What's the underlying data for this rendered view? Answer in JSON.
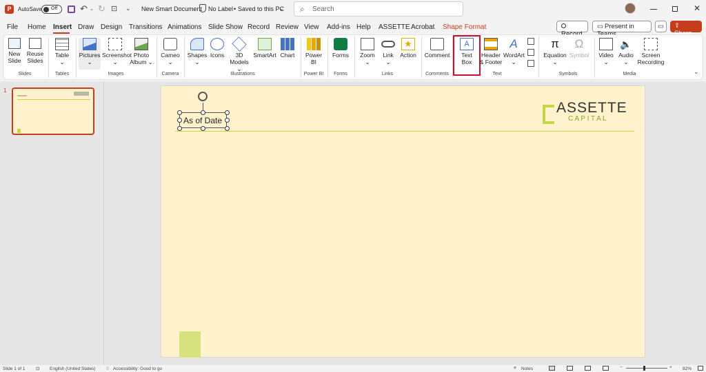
{
  "titlebar": {
    "autosave_label": "AutoSave",
    "autosave_state": "Off",
    "doc_title": "New Smart Document",
    "label_status": "No Label",
    "save_status": "Saved to this PC",
    "search_placeholder": "Search"
  },
  "menu": {
    "tabs": [
      "File",
      "Home",
      "Insert",
      "Draw",
      "Design",
      "Transitions",
      "Animations",
      "Slide Show",
      "Record",
      "Review",
      "View",
      "Add-ins",
      "Help",
      "ASSETTE",
      "Acrobat",
      "Shape Format"
    ],
    "active_tab": "Insert",
    "record_btn": "Record",
    "present_btn": "Present in Teams",
    "share_btn": "Share"
  },
  "ribbon": {
    "new_slide": [
      "New",
      "Slide"
    ],
    "reuse_slides": [
      "Reuse",
      "Slides"
    ],
    "table": "Table",
    "pictures": "Pictures",
    "screenshot": "Screenshot",
    "photo_album": [
      "Photo",
      "Album"
    ],
    "cameo": "Cameo",
    "shapes": "Shapes",
    "icons": "Icons",
    "models_3d": [
      "3D",
      "Models"
    ],
    "smartart": "SmartArt",
    "chart": "Chart",
    "power_bi": [
      "Power",
      "BI"
    ],
    "forms": "Forms",
    "zoom": "Zoom",
    "link": "Link",
    "action": "Action",
    "comment": "Comment",
    "text_box": [
      "Text",
      "Box"
    ],
    "header_footer": [
      "Header",
      "& Footer"
    ],
    "wordart": "WordArt",
    "equation": "Equation",
    "symbol": "Symbol",
    "video": "Video",
    "audio": "Audio",
    "screen_recording": [
      "Screen",
      "Recording"
    ],
    "groups": {
      "slides": "Slides",
      "tables": "Tables",
      "images": "Images",
      "camera": "Camera",
      "illustrations": "Illustrations",
      "power_bi": "Power BI",
      "forms": "Forms",
      "links": "Links",
      "comments": "Comments",
      "text": "Text",
      "symbols": "Symbols",
      "media": "Media"
    }
  },
  "thumbnail": {
    "number": "1"
  },
  "slide": {
    "textbox": "As of Date",
    "logo_top": "ASSETTE",
    "logo_bottom": "C A P I T A L",
    "accent_color": "#c4d64a"
  },
  "status": {
    "slide_info": "Slide 1 of 1",
    "language": "English (United States)",
    "accessibility": "Accessibility: Good to go",
    "notes": "Notes",
    "zoom": "82%"
  },
  "colors": {
    "accent": "#c43e1c",
    "slide_bg": "#fff2cc",
    "highlight": "#c8102e"
  }
}
